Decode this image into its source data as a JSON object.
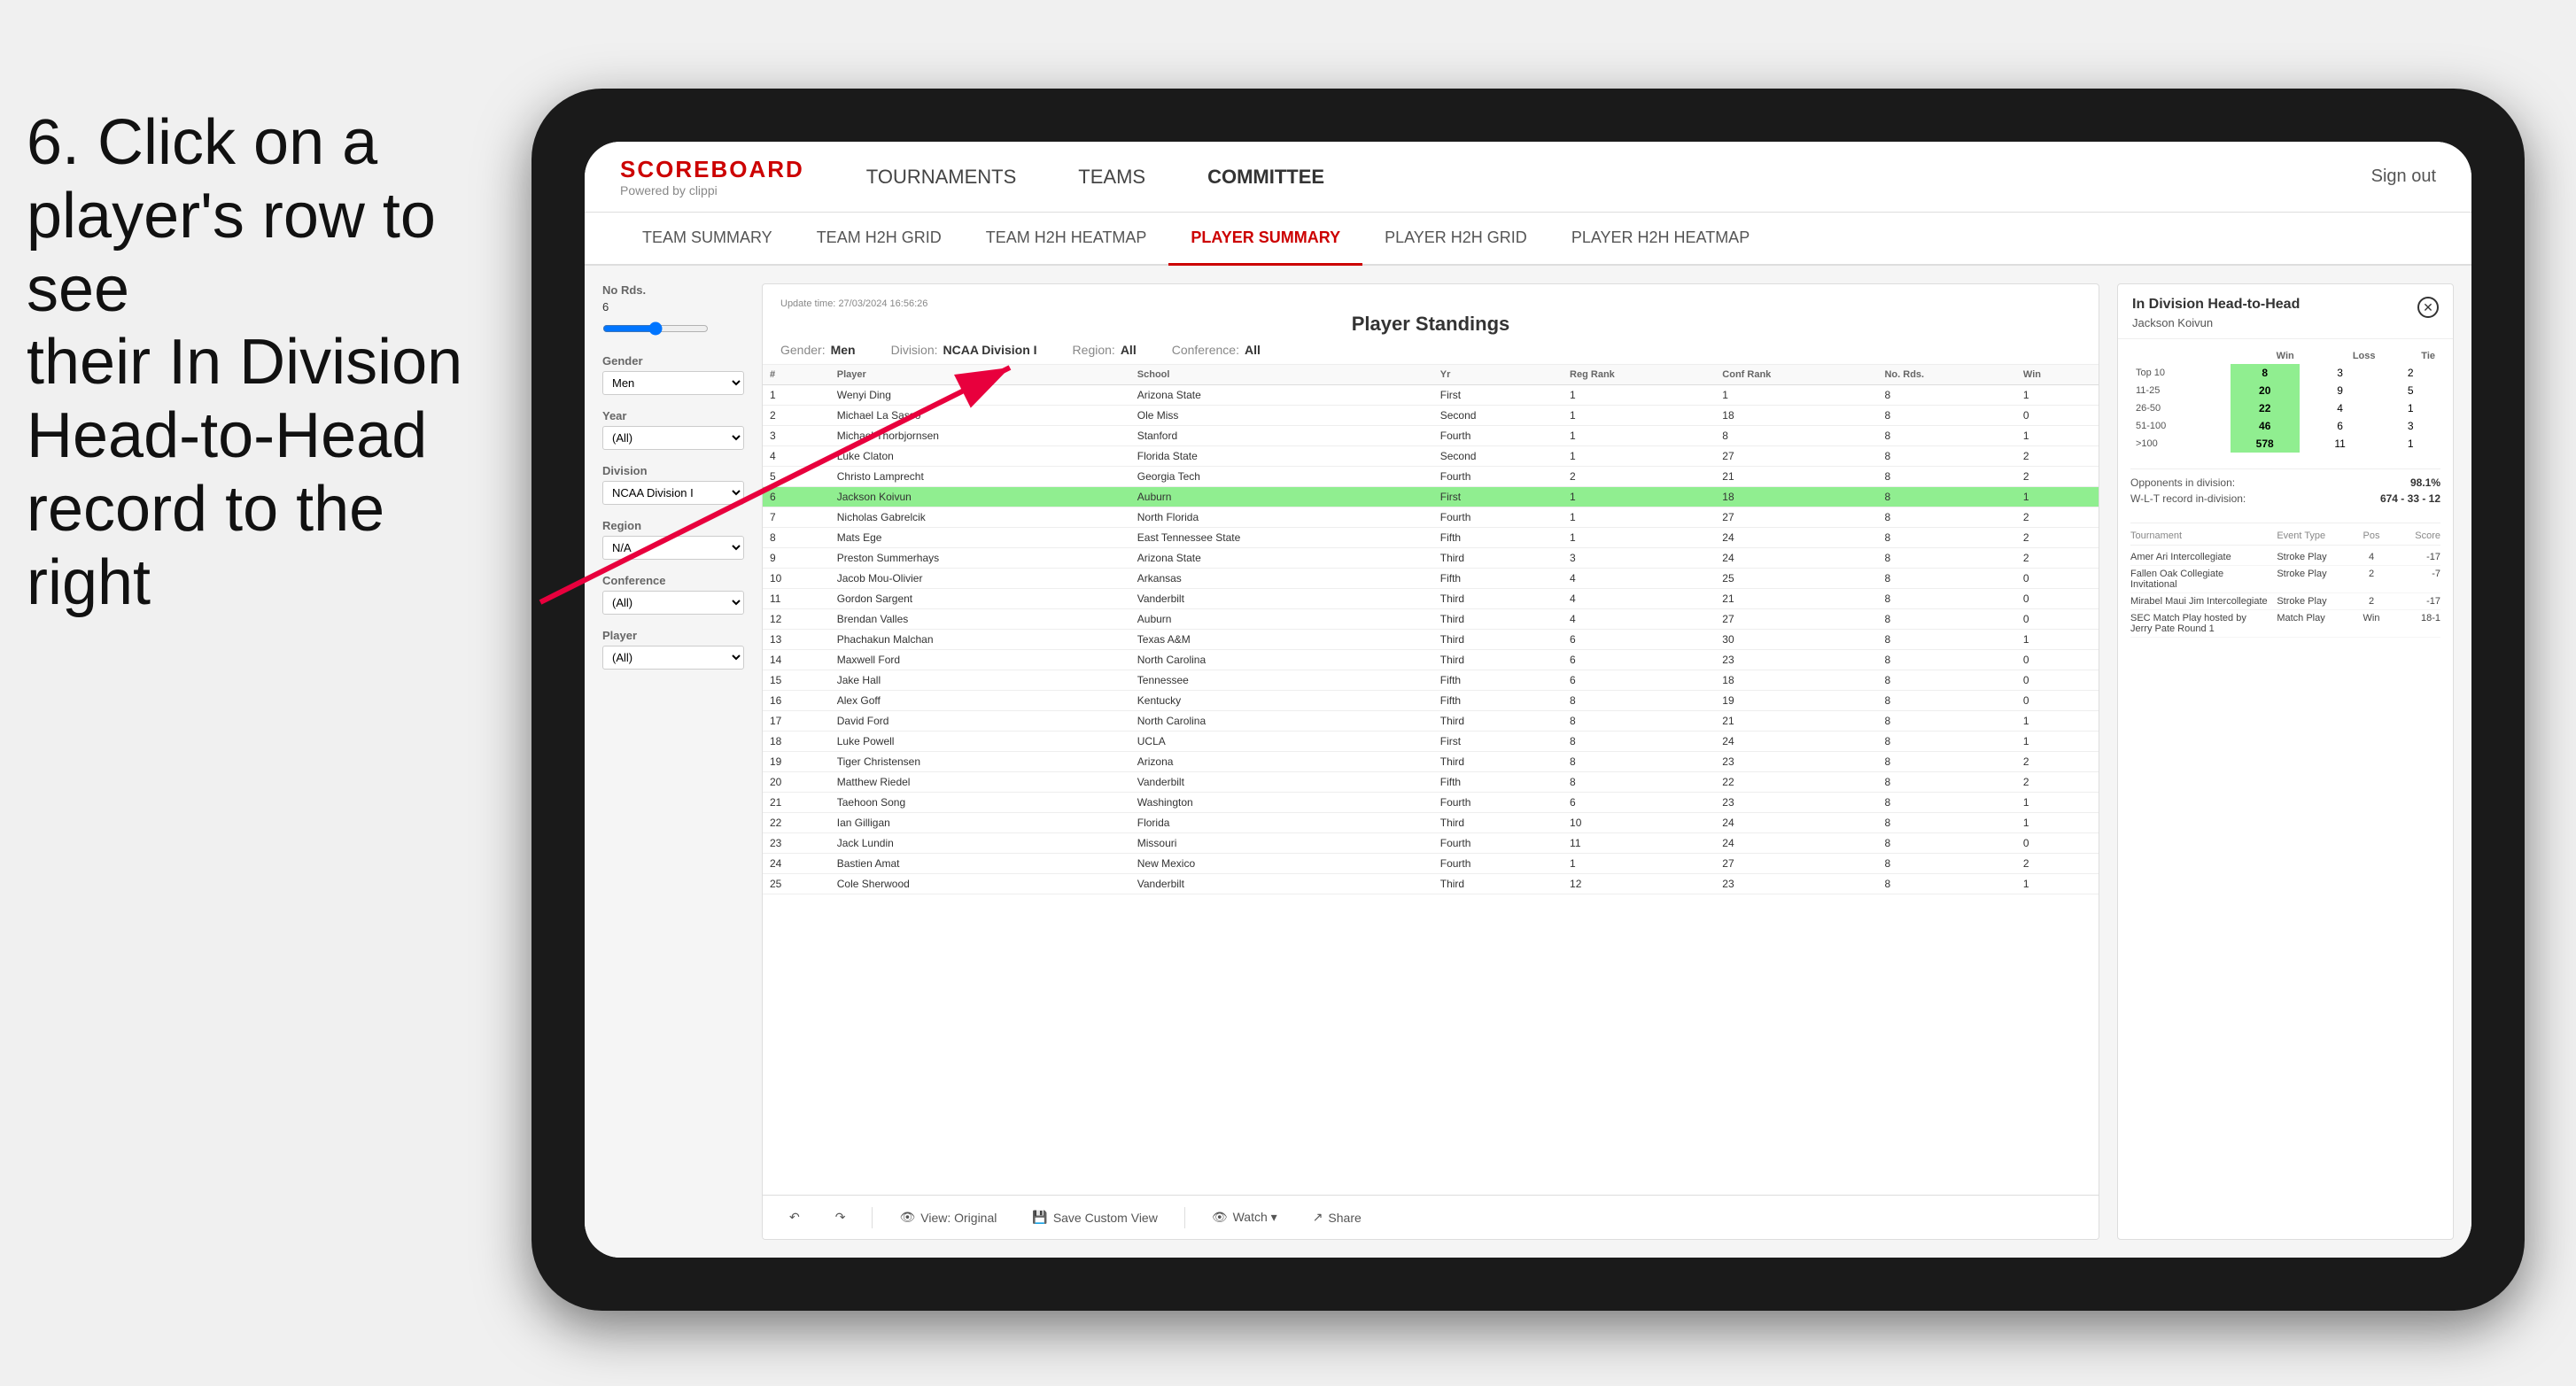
{
  "instruction": {
    "line1": "6. Click on a",
    "line2": "player's row to see",
    "line3": "their In Division",
    "line4": "Head-to-Head",
    "line5": "record to the right"
  },
  "nav": {
    "logo": "SCOREBOARD",
    "logo_sub": "Powered by clippi",
    "links": [
      "TOURNAMENTS",
      "TEAMS",
      "COMMITTEE"
    ],
    "sign_out": "Sign out"
  },
  "sub_nav": {
    "links": [
      "TEAM SUMMARY",
      "TEAM H2H GRID",
      "TEAM H2H HEATMAP",
      "PLAYER SUMMARY",
      "PLAYER H2H GRID",
      "PLAYER H2H HEATMAP"
    ],
    "active": "PLAYER SUMMARY"
  },
  "sidebar": {
    "no_rds_label": "No Rds.",
    "no_rds_value": "6",
    "gender_label": "Gender",
    "gender_value": "Men",
    "year_label": "Year",
    "year_value": "(All)",
    "division_label": "Division",
    "division_value": "NCAA Division I",
    "region_label": "Region",
    "region_value": "N/A",
    "conference_label": "Conference",
    "conference_value": "(All)",
    "player_label": "Player",
    "player_value": "(All)"
  },
  "panel": {
    "title": "Player Standings",
    "update_time": "Update time:",
    "update_date": "27/03/2024 16:56:26",
    "gender": "Men",
    "division": "NCAA Division I",
    "region": "All",
    "conference": "All"
  },
  "table": {
    "headers": [
      "#",
      "Player",
      "School",
      "Yr",
      "Reg Rank",
      "Conf Rank",
      "No. Rds.",
      "Win"
    ],
    "rows": [
      {
        "num": 1,
        "player": "Wenyi Ding",
        "school": "Arizona State",
        "yr": "First",
        "reg": 1,
        "conf": 1,
        "rds": 8,
        "win": 1,
        "highlighted": false
      },
      {
        "num": 2,
        "player": "Michael La Sasso",
        "school": "Ole Miss",
        "yr": "Second",
        "reg": 1,
        "conf": 18,
        "rds": 8,
        "win": 0,
        "highlighted": false
      },
      {
        "num": 3,
        "player": "Michael Thorbjornsen",
        "school": "Stanford",
        "yr": "Fourth",
        "reg": 1,
        "conf": 8,
        "rds": 8,
        "win": 1,
        "highlighted": false
      },
      {
        "num": 4,
        "player": "Luke Claton",
        "school": "Florida State",
        "yr": "Second",
        "reg": 1,
        "conf": 27,
        "rds": 8,
        "win": 2,
        "highlighted": false
      },
      {
        "num": 5,
        "player": "Christo Lamprecht",
        "school": "Georgia Tech",
        "yr": "Fourth",
        "reg": 2,
        "conf": 21,
        "rds": 8,
        "win": 2,
        "highlighted": false
      },
      {
        "num": 6,
        "player": "Jackson Koivun",
        "school": "Auburn",
        "yr": "First",
        "reg": 1,
        "conf": 18,
        "rds": 8,
        "win": 1,
        "highlighted": true
      },
      {
        "num": 7,
        "player": "Nicholas Gabrelcik",
        "school": "North Florida",
        "yr": "Fourth",
        "reg": 1,
        "conf": 27,
        "rds": 8,
        "win": 2,
        "highlighted": false
      },
      {
        "num": 8,
        "player": "Mats Ege",
        "school": "East Tennessee State",
        "yr": "Fifth",
        "reg": 1,
        "conf": 24,
        "rds": 8,
        "win": 2,
        "highlighted": false
      },
      {
        "num": 9,
        "player": "Preston Summerhays",
        "school": "Arizona State",
        "yr": "Third",
        "reg": 3,
        "conf": 24,
        "rds": 8,
        "win": 2,
        "highlighted": false
      },
      {
        "num": 10,
        "player": "Jacob Mou-Olivier",
        "school": "Arkansas",
        "yr": "Fifth",
        "reg": 4,
        "conf": 25,
        "rds": 8,
        "win": 0,
        "highlighted": false
      },
      {
        "num": 11,
        "player": "Gordon Sargent",
        "school": "Vanderbilt",
        "yr": "Third",
        "reg": 4,
        "conf": 21,
        "rds": 8,
        "win": 0,
        "highlighted": false
      },
      {
        "num": 12,
        "player": "Brendan Valles",
        "school": "Auburn",
        "yr": "Third",
        "reg": 4,
        "conf": 27,
        "rds": 8,
        "win": 0,
        "highlighted": false
      },
      {
        "num": 13,
        "player": "Phachakun Malchan",
        "school": "Texas A&M",
        "yr": "Third",
        "reg": 6,
        "conf": 30,
        "rds": 8,
        "win": 1,
        "highlighted": false
      },
      {
        "num": 14,
        "player": "Maxwell Ford",
        "school": "North Carolina",
        "yr": "Third",
        "reg": 6,
        "conf": 23,
        "rds": 8,
        "win": 0,
        "highlighted": false
      },
      {
        "num": 15,
        "player": "Jake Hall",
        "school": "Tennessee",
        "yr": "Fifth",
        "reg": 6,
        "conf": 18,
        "rds": 8,
        "win": 0,
        "highlighted": false
      },
      {
        "num": 16,
        "player": "Alex Goff",
        "school": "Kentucky",
        "yr": "Fifth",
        "reg": 8,
        "conf": 19,
        "rds": 8,
        "win": 0,
        "highlighted": false
      },
      {
        "num": 17,
        "player": "David Ford",
        "school": "North Carolina",
        "yr": "Third",
        "reg": 8,
        "conf": 21,
        "rds": 8,
        "win": 1,
        "highlighted": false
      },
      {
        "num": 18,
        "player": "Luke Powell",
        "school": "UCLA",
        "yr": "First",
        "reg": 8,
        "conf": 24,
        "rds": 8,
        "win": 1,
        "highlighted": false
      },
      {
        "num": 19,
        "player": "Tiger Christensen",
        "school": "Arizona",
        "yr": "Third",
        "reg": 8,
        "conf": 23,
        "rds": 8,
        "win": 2,
        "highlighted": false
      },
      {
        "num": 20,
        "player": "Matthew Riedel",
        "school": "Vanderbilt",
        "yr": "Fifth",
        "reg": 8,
        "conf": 22,
        "rds": 8,
        "win": 2,
        "highlighted": false
      },
      {
        "num": 21,
        "player": "Taehoon Song",
        "school": "Washington",
        "yr": "Fourth",
        "reg": 6,
        "conf": 23,
        "rds": 8,
        "win": 1,
        "highlighted": false
      },
      {
        "num": 22,
        "player": "Ian Gilligan",
        "school": "Florida",
        "yr": "Third",
        "reg": 10,
        "conf": 24,
        "rds": 8,
        "win": 1,
        "highlighted": false
      },
      {
        "num": 23,
        "player": "Jack Lundin",
        "school": "Missouri",
        "yr": "Fourth",
        "reg": 11,
        "conf": 24,
        "rds": 8,
        "win": 0,
        "highlighted": false
      },
      {
        "num": 24,
        "player": "Bastien Amat",
        "school": "New Mexico",
        "yr": "Fourth",
        "reg": 1,
        "conf": 27,
        "rds": 8,
        "win": 2,
        "highlighted": false
      },
      {
        "num": 25,
        "player": "Cole Sherwood",
        "school": "Vanderbilt",
        "yr": "Third",
        "reg": 12,
        "conf": 23,
        "rds": 8,
        "win": 1,
        "highlighted": false
      }
    ]
  },
  "h2h": {
    "title": "In Division Head-to-Head",
    "player": "Jackson Koivun",
    "table_headers": [
      "",
      "Win",
      "Loss",
      "Tie"
    ],
    "rows": [
      {
        "label": "Top 10",
        "win": 8,
        "loss": 3,
        "tie": 2
      },
      {
        "label": "11-25",
        "win": 20,
        "loss": 9,
        "tie": 5
      },
      {
        "label": "26-50",
        "win": 22,
        "loss": 4,
        "tie": 1
      },
      {
        "label": "51-100",
        "win": 46,
        "loss": 6,
        "tie": 3
      },
      {
        "label": ">100",
        "win": 578,
        "loss": 11,
        "tie": 1
      }
    ],
    "opponents_label": "Opponents in division:",
    "opponents_value": "98.1%",
    "wlt_label": "W-L-T record in-division:",
    "wlt_value": "674 - 33 - 12",
    "tournament_cols": [
      "Tournament",
      "Event Type",
      "Pos",
      "Score"
    ],
    "tournaments": [
      {
        "name": "Amer Ari Intercollegiate",
        "type": "Stroke Play",
        "pos": 4,
        "score": "-17"
      },
      {
        "name": "Fallen Oak Collegiate Invitational",
        "type": "Stroke Play",
        "pos": 2,
        "score": "-7"
      },
      {
        "name": "Mirabel Maui Jim Intercollegiate",
        "type": "Stroke Play",
        "pos": 2,
        "score": "-17"
      },
      {
        "name": "SEC Match Play hosted by Jerry Pate Round 1",
        "type": "Match Play",
        "pos": "Win",
        "score": "18-1"
      }
    ]
  },
  "toolbar": {
    "view_label": "View: Original",
    "save_label": "Save Custom View",
    "watch_label": "Watch ▾",
    "share_label": "Share"
  }
}
